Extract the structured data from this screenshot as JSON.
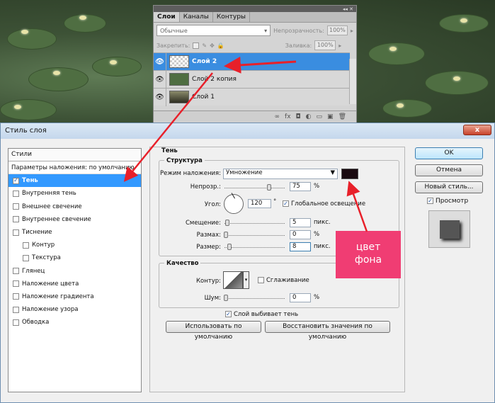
{
  "layers_panel": {
    "tabs": [
      "Слои",
      "Каналы",
      "Контуры"
    ],
    "blend_mode": "Обычные",
    "opacity_label": "Непрозрачность:",
    "opacity_value": "100%",
    "lock_label": "Закрепить:",
    "fill_label": "Заливка:",
    "fill_value": "100%",
    "layers": [
      {
        "name": "Слой 2",
        "selected": true
      },
      {
        "name": "Слой 2 копия",
        "selected": false
      },
      {
        "name": "Слой 1",
        "selected": false
      }
    ],
    "top_icons": "◂◂ ✕",
    "bottom_icons": [
      "∞",
      "fx",
      "◘",
      "◐",
      "▭",
      "▣",
      "🗑"
    ]
  },
  "dialog": {
    "title": "Стиль слоя",
    "close": "x",
    "styles_header": "Стили",
    "blend_options": "Параметры наложения: по умолчанию",
    "style_items": [
      {
        "label": "Тень",
        "checked": true,
        "selected": true,
        "sub": false
      },
      {
        "label": "Внутренняя тень",
        "checked": false,
        "sub": false
      },
      {
        "label": "Внешнее свечение",
        "checked": false,
        "sub": false
      },
      {
        "label": "Внутреннее свечение",
        "checked": false,
        "sub": false
      },
      {
        "label": "Тиснение",
        "checked": false,
        "sub": false
      },
      {
        "label": "Контур",
        "checked": false,
        "sub": true
      },
      {
        "label": "Текстура",
        "checked": false,
        "sub": true
      },
      {
        "label": "Глянец",
        "checked": false,
        "sub": false
      },
      {
        "label": "Наложение цвета",
        "checked": false,
        "sub": false
      },
      {
        "label": "Наложение градиента",
        "checked": false,
        "sub": false
      },
      {
        "label": "Наложение узора",
        "checked": false,
        "sub": false
      },
      {
        "label": "Обводка",
        "checked": false,
        "sub": false
      }
    ],
    "panel_title": "Тень",
    "structure_title": "Структура",
    "blend_mode_label": "Режим наложения:",
    "blend_mode_value": "Умножение",
    "shadow_color": "#1a0a10",
    "opacity_label": "Непрозр.:",
    "opacity_value": "75",
    "percent": "%",
    "angle_label": "Угол:",
    "angle_value": "120",
    "degree": "°",
    "global_light_label": "Глобальное освещение",
    "global_light_checked": true,
    "distance_label": "Смещение:",
    "distance_value": "5",
    "spread_label": "Размах:",
    "spread_value": "0",
    "size_label": "Размер:",
    "size_value": "8",
    "px": "пикс.",
    "quality_title": "Качество",
    "contour_label": "Контур:",
    "antialias_label": "Сглаживание",
    "noise_label": "Шум:",
    "noise_value": "0",
    "knockout_label": "Слой выбивает тень",
    "knockout_checked": true,
    "make_default": "Использовать по умолчанию",
    "reset_default": "Восстановить значения по умолчанию",
    "ok": "OK",
    "cancel": "Отмена",
    "new_style": "Новый стиль...",
    "preview_label": "Просмотр",
    "preview_checked": true
  },
  "annotation": {
    "text_line1": "цвет",
    "text_line2": "фона",
    "color": "#f03d73",
    "arrow_color": "#e8202a"
  }
}
